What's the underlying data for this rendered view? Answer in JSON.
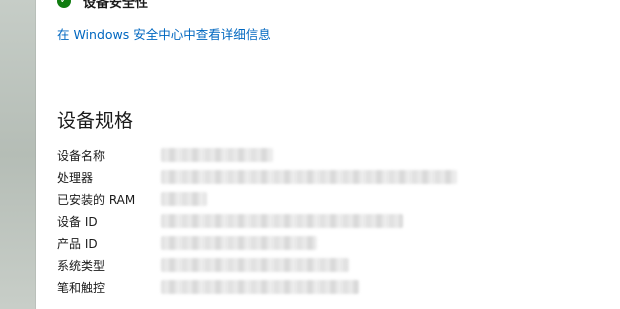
{
  "status": {
    "text": "设备安全性",
    "icon": "check-circle-icon",
    "icon_glyph": "✓",
    "icon_color": "#107c10"
  },
  "link_text": "在 Windows 安全中心中查看详细信息",
  "link_color": "#0067c0",
  "section_title": "设备规格",
  "specs": [
    {
      "label": "设备名称",
      "value_state": "blurred"
    },
    {
      "label": "处理器",
      "value_state": "blurred"
    },
    {
      "label": "已安装的 RAM",
      "value_state": "blurred"
    },
    {
      "label": "设备 ID",
      "value_state": "blurred"
    },
    {
      "label": "产品 ID",
      "value_state": "blurred"
    },
    {
      "label": "系统类型",
      "value_state": "blurred"
    },
    {
      "label": "笔和触控",
      "value_state": "blurred"
    }
  ]
}
